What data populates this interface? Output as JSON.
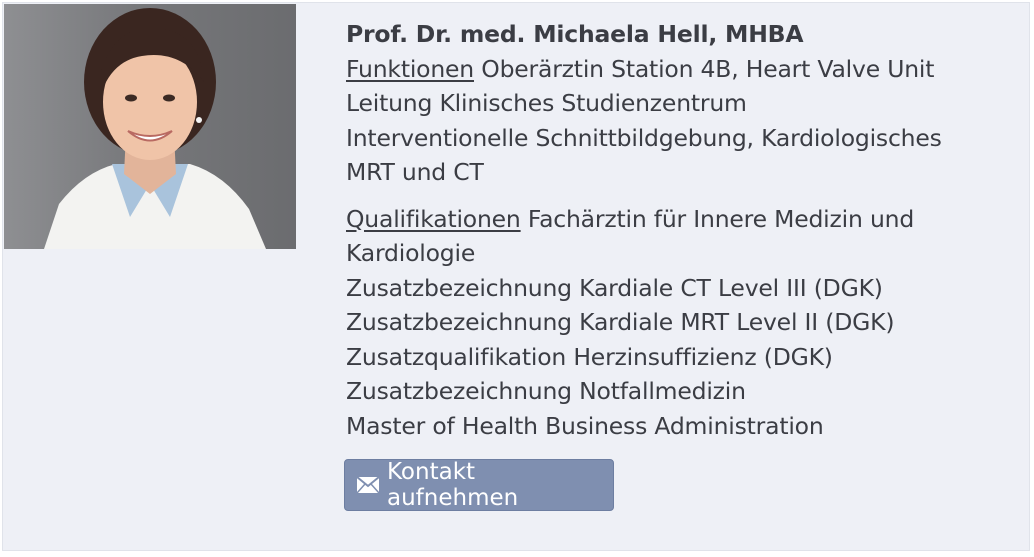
{
  "profile": {
    "photo_alt": "Prof. Dr. med. Michaela Hell, MHBA",
    "name": "Prof. Dr. med. Michaela Hell, MHBA",
    "funktionen": {
      "label": "Funktionen",
      "first_line": "Oberärztin Station 4B, Heart Valve Unit",
      "lines": [
        "Leitung Klinisches Studienzentrum",
        "Interventionelle Schnittbildgebung, Kardiologisches",
        "MRT und CT"
      ]
    },
    "qualifikationen": {
      "label": "Qualifikationen",
      "first_line": "Fachärztin für Innere Medizin und",
      "lines": [
        "Kardiologie",
        "Zusatzbezeichnung Kardiale CT Level III (DGK)",
        "Zusatzbezeichnung Kardiale MRT Level II (DGK)",
        "Zusatzqualifikation Herzinsuffizienz (DGK)",
        "Zusatzbezeichnung Notfallmedizin",
        "Master of Health Business Administration"
      ]
    },
    "contact_button": {
      "icon": "envelope-icon",
      "label": "Kontakt aufnehmen"
    }
  },
  "colors": {
    "card_background": "#eef0f6",
    "text": "#3b3d44",
    "button_background": "#7f8fb0",
    "button_text": "#ffffff"
  }
}
